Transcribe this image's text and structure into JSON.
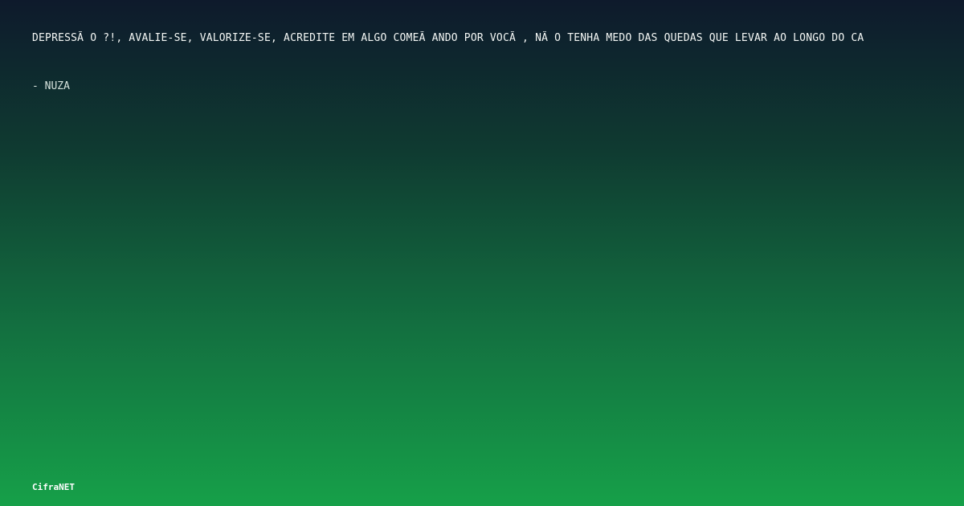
{
  "quote": {
    "text": "DEPRESSÃ O ?!, AVALIE-SE, VALORIZE-SE, ACREDITE EM ALGO COMEÃ ANDO POR VOCÃ , NÃ O TENHA MEDO DAS QUEDAS QUE LEVAR AO LONGO DO CA"
  },
  "author": {
    "text": "- NUZA"
  },
  "brand": {
    "name": "CifraNET"
  }
}
